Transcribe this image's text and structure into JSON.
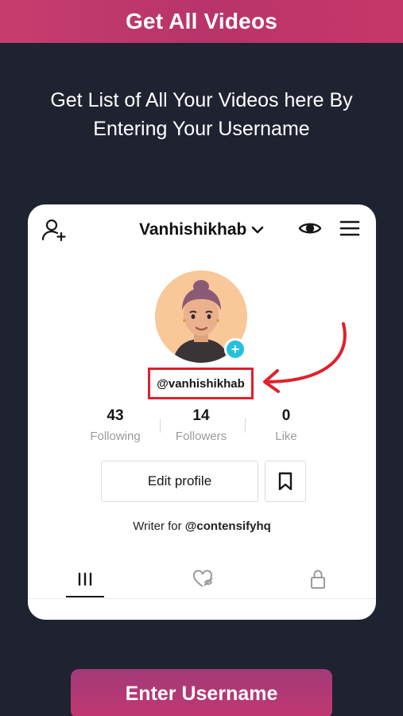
{
  "header": {
    "title": "Get All Videos"
  },
  "instructions": {
    "line1": "Get List of All Your Videos here By",
    "line2": "Entering Your Username"
  },
  "profile_card": {
    "display_name": "Vanhishikhab",
    "handle": "@vanhishikhab",
    "stats": [
      {
        "value": "43",
        "label": "Following"
      },
      {
        "value": "14",
        "label": "Followers"
      },
      {
        "value": "0",
        "label": "Like"
      }
    ],
    "edit_profile_label": "Edit profile",
    "bio_prefix": "Writer for ",
    "bio_mention": "@contensifyhq",
    "highlight_color": "#e0202c",
    "accent_badge_color": "#25c1dc"
  },
  "cta": {
    "label": "Enter Username"
  },
  "colors": {
    "background": "#1f2230",
    "brand": "#c23770"
  }
}
